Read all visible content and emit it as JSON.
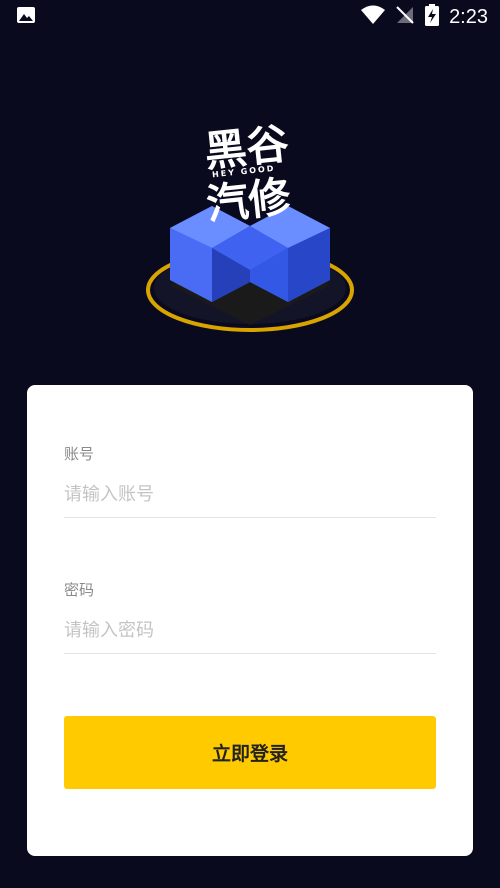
{
  "status_bar": {
    "time": "2:23",
    "icons": [
      "image-icon",
      "wifi-icon",
      "no-signal-icon",
      "battery-charging-icon"
    ]
  },
  "logo": {
    "title_line1": "黑谷",
    "title_line2": "汽修",
    "subtitle": "HEY GOOD"
  },
  "login_form": {
    "account_label": "账号",
    "account_placeholder": "请输入账号",
    "password_label": "密码",
    "password_placeholder": "请输入密码",
    "submit_label": "立即登录"
  },
  "colors": {
    "background": "#0a0a1f",
    "accent": "#ffcb00",
    "cube_blue": "#3b6bff",
    "ring_gold": "#d9a400"
  }
}
